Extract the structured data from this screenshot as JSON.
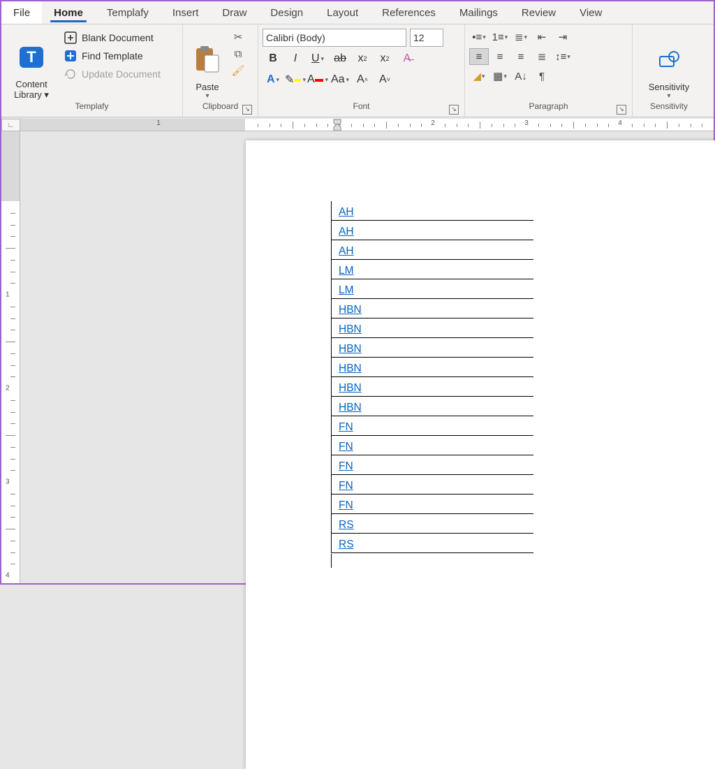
{
  "tabs": {
    "file": "File",
    "home": "Home",
    "templafy": "Templafy",
    "insert": "Insert",
    "draw": "Draw",
    "design": "Design",
    "layout": "Layout",
    "references": "References",
    "mailings": "Mailings",
    "review": "Review",
    "view": "View",
    "active": "home"
  },
  "groups": {
    "templafy": {
      "label": "Templafy",
      "content_library": "Content Library",
      "blank_doc": "Blank Document",
      "find_template": "Find Template",
      "update_doc": "Update Document"
    },
    "clipboard": {
      "label": "Clipboard",
      "paste": "Paste"
    },
    "font": {
      "label": "Font",
      "name": "Calibri (Body)",
      "size": "12"
    },
    "paragraph": {
      "label": "Paragraph"
    },
    "sensitivity": {
      "label": "Sensitivity",
      "btn": "Sensitivity"
    }
  },
  "ruler": {
    "h_labels": [
      "1",
      "1",
      "2",
      "3",
      "4"
    ],
    "v_labels": [
      "1",
      "2",
      "3",
      "4"
    ]
  },
  "document": {
    "rows": [
      "AH",
      "AH",
      "AH",
      "LM",
      "LM",
      "HBN",
      "HBN",
      "HBN",
      "HBN",
      "HBN",
      "HBN",
      "FN",
      "FN",
      "FN",
      "FN",
      "FN",
      "RS",
      "RS"
    ]
  },
  "colors": {
    "highlight": "#ffff00",
    "font": "#ff0000"
  }
}
